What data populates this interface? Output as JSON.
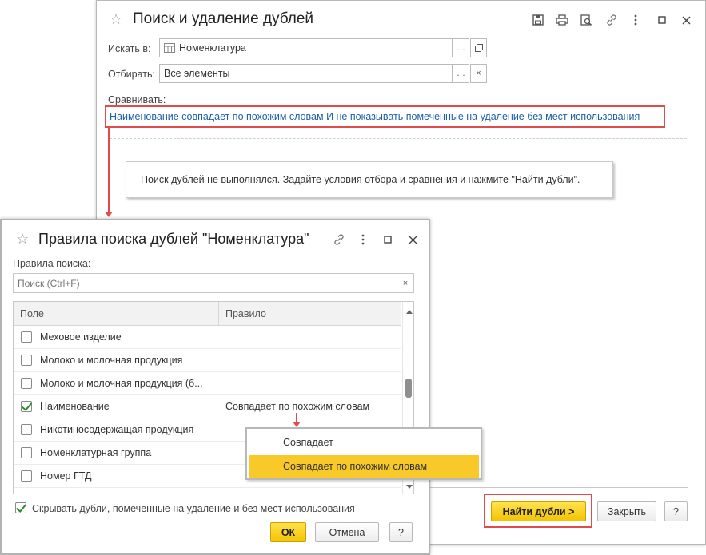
{
  "main": {
    "title": "Поиск и удаление дублей",
    "search_in_label": "Искать в:",
    "search_in_value": "Номенклатура",
    "filter_label": "Отбирать:",
    "filter_value": "Все элементы",
    "compare_label": "Сравнивать:",
    "compare_link": "Наименование совпадает по похожим словам И не показывать помеченные на удаление без мест использования",
    "info_message": "Поиск дублей не выполнялся.  Задайте условия отбора и сравнения и нажмите \"Найти дубли\".",
    "find_button": "Найти дубли >",
    "close_button": "Закрыть",
    "help_button": "?"
  },
  "dialog": {
    "title": "Правила поиска дублей \"Номенклатура\"",
    "rules_label": "Правила поиска:",
    "search_placeholder": "Поиск (Ctrl+F)",
    "columns": [
      "Поле",
      "Правило"
    ],
    "rows": [
      {
        "field": "Меховое изделие",
        "rule": "",
        "checked": false
      },
      {
        "field": "Молоко и молочная продукция",
        "rule": "",
        "checked": false
      },
      {
        "field": "Молоко и молочная продукция (б...",
        "rule": "",
        "checked": false
      },
      {
        "field": "Наименование",
        "rule": "Совпадает по похожим словам",
        "checked": true
      },
      {
        "field": "Никотиносодержащая продукция",
        "rule": "",
        "checked": false
      },
      {
        "field": "Номенклатурная группа",
        "rule": "",
        "checked": false
      },
      {
        "field": "Номер ГТД",
        "rule": "",
        "checked": false
      }
    ],
    "hide_label": "Скрывать дубли, помеченные на удаление и без мест использования",
    "hide_checked": true,
    "ok_button": "ОК",
    "cancel_button": "Отмена",
    "help_button": "?"
  },
  "dropdown": {
    "options": [
      "Совпадает",
      "Совпадает по похожим словам"
    ],
    "selected_index": 1
  },
  "colors": {
    "accent_yellow": "#f8c928",
    "highlight_red": "#e24b4b",
    "link_blue": "#1f5fa8"
  }
}
